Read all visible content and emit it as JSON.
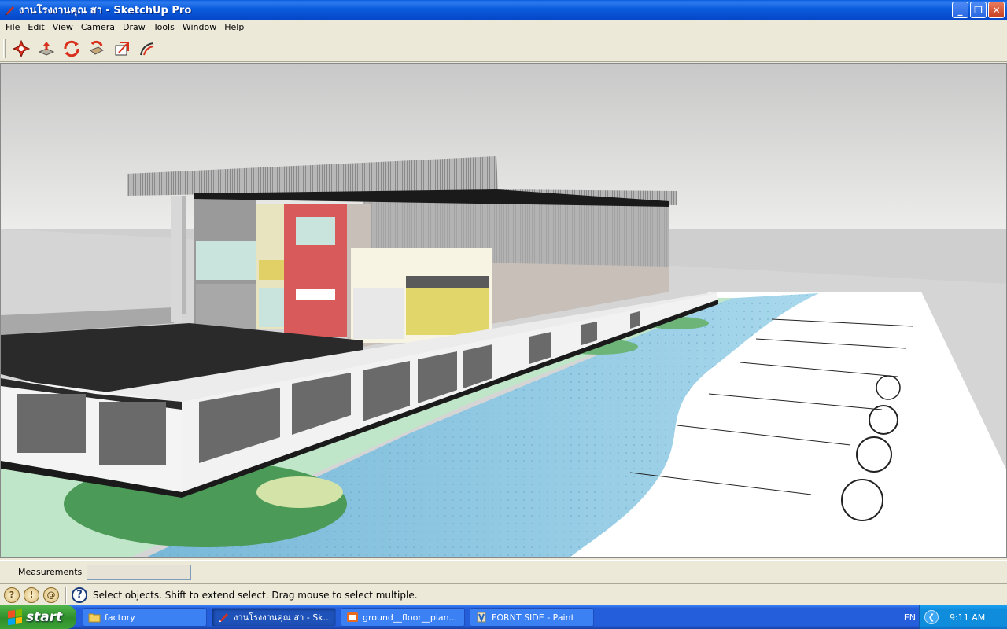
{
  "window": {
    "title": "งานโรงงานคุณ สา - SketchUp Pro",
    "buttons": {
      "minimize": "_",
      "restore": "❐",
      "close": "✕"
    }
  },
  "menu": [
    "File",
    "Edit",
    "View",
    "Camera",
    "Draw",
    "Tools",
    "Window",
    "Help"
  ],
  "toolbar": {
    "tools": [
      "orbit-tool",
      "pan-tool",
      "rotate-tool",
      "push-pull-tool",
      "scale-tool",
      "follow-me-tool"
    ]
  },
  "measurements": {
    "label": "Measurements",
    "value": ""
  },
  "status": {
    "icons": [
      "geo-location-icon",
      "credits-icon",
      "account-icon"
    ],
    "help_glyph": "?",
    "text": "Select objects. Shift to extend select. Drag mouse to select multiple."
  },
  "taskbar": {
    "start_label": "start",
    "tasks": [
      {
        "label": "factory",
        "icon": "folder-icon",
        "active": false
      },
      {
        "label": "งานโรงงานคุณ สา - Sk...",
        "icon": "sketchup-icon",
        "active": true
      },
      {
        "label": "ground__floor__plan...",
        "icon": "office-icon",
        "active": false
      },
      {
        "label": "FORNT SIDE - Paint",
        "icon": "paint-icon",
        "active": false
      }
    ],
    "language": "EN",
    "clock": "9:11 AM"
  },
  "colors": {
    "sky": "#e4e4e2",
    "ground": "#c8c8c8",
    "water": "#8fc8e0",
    "red_wall": "#d95a5a",
    "yellow_wall": "#e0d66a"
  }
}
